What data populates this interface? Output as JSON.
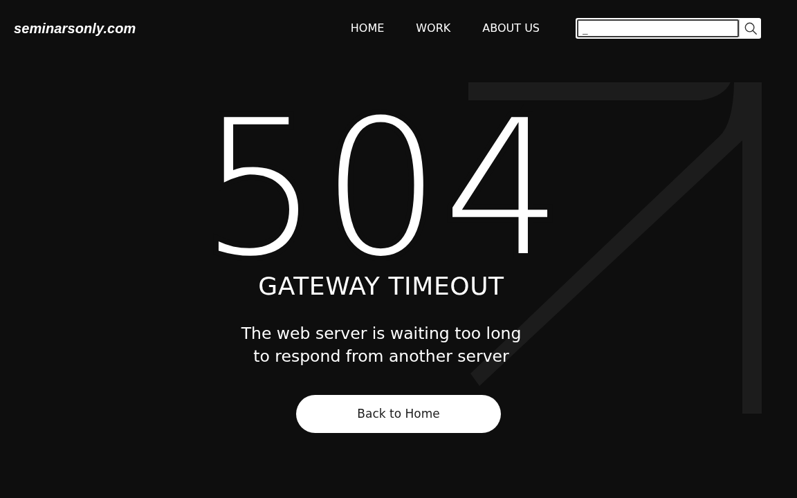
{
  "header": {
    "logo": "seminarsonly.com",
    "nav": [
      {
        "label": "HOME"
      },
      {
        "label": "WORK"
      },
      {
        "label": "ABOUT US"
      }
    ],
    "search": {
      "value": "_"
    }
  },
  "error": {
    "code": "504",
    "title": "GATEWAY TIMEOUT",
    "message": "The web server is waiting too long\nto respond from another server",
    "button": "Back to Home"
  }
}
